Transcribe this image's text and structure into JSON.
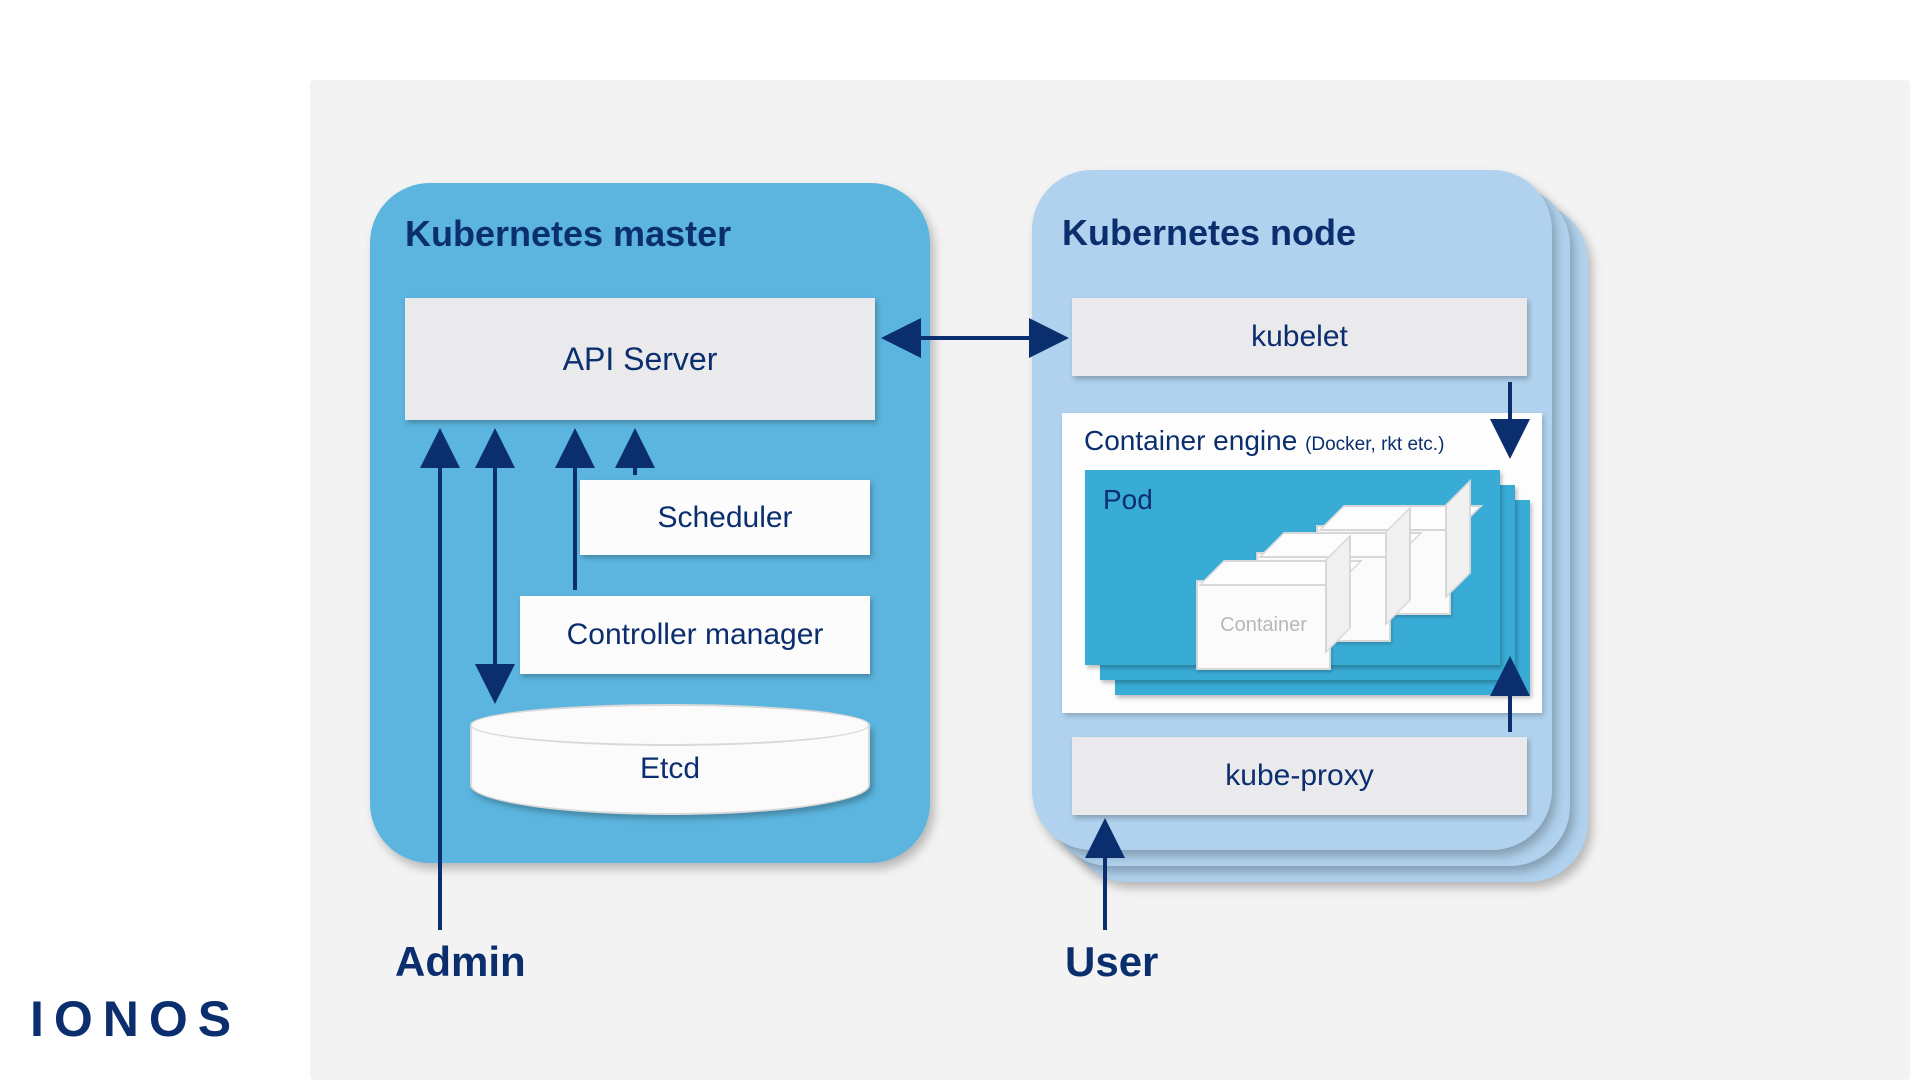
{
  "logo": "IONOS",
  "master": {
    "title": "Kubernetes master",
    "api": "API Server",
    "scheduler": "Scheduler",
    "controller": "Controller manager",
    "etcd": "Etcd"
  },
  "node": {
    "title": "Kubernetes node",
    "kubelet": "kubelet",
    "engine": "Container engine",
    "engine_detail": "(Docker, rkt etc.)",
    "pod": "Pod",
    "container": "Container",
    "kubeproxy": "kube-proxy"
  },
  "actors": {
    "admin": "Admin",
    "user": "User"
  }
}
